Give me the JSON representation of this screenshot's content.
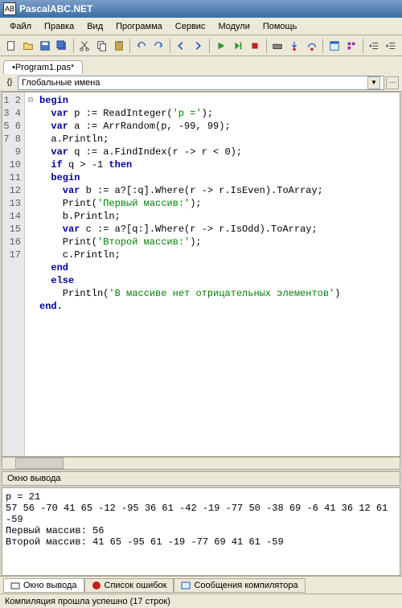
{
  "window": {
    "title": "PascalABC.NET",
    "icon_label": "AB"
  },
  "menu": {
    "file": "Файл",
    "edit": "Правка",
    "view": "Вид",
    "program": "Программа",
    "service": "Сервис",
    "modules": "Модули",
    "help": "Помощь"
  },
  "tab": {
    "label": "•Program1.pas*"
  },
  "dropdown": {
    "text": "Глобальные имена"
  },
  "gutter_lines": "1\n2\n3\n4\n5\n6\n7\n8\n9\n10\n11\n12\n13\n14\n15\n16\n17",
  "fold_marks": "⊟\n\n\n\n\n\n\n\n\n\n\n\n\n\n\n\n",
  "code": {
    "l1a": "begin",
    "l2a": "  var",
    "l2b": " p := ReadInteger(",
    "l2c": "'p ='",
    "l2d": ");",
    "l3a": "  var",
    "l3b": " a := ArrRandom(p, -99, 99);",
    "l4": "  a.Println;",
    "l5a": "  var",
    "l5b": " q := a.FindIndex(r -> r < 0);",
    "l6a": "  if",
    "l6b": " q > -1 ",
    "l6c": "then",
    "l7": "  begin",
    "l8a": "    var",
    "l8b": " b := a?[:q].Where(r -> r.IsEven).ToArray;",
    "l9a": "    Print(",
    "l9b": "'Первый массив:'",
    "l9c": ");",
    "l10": "    b.Println;",
    "l11a": "    var",
    "l11b": " c := a?[q:].Where(r -> r.IsOdd).ToArray;",
    "l12a": "    Print(",
    "l12b": "'Второй массив:'",
    "l12c": ");",
    "l13": "    c.Println;",
    "l14": "  end",
    "l15": "  else",
    "l16a": "    Println(",
    "l16b": "'В массиве нет отрицательных элементов'",
    "l16c": ")",
    "l17": "end."
  },
  "output": {
    "title": "Окно вывода",
    "content": "p = 21\n57 56 -70 41 65 -12 -95 36 61 -42 -19 -77 50 -38 69 -6 41 36 12 61 -59\nПервый массив: 56\nВторой массив: 41 65 -95 61 -19 -77 69 41 61 -59"
  },
  "bottom_tabs": {
    "output": "Окно вывода",
    "errors": "Список ошибок",
    "compiler": "Сообщения компилятора"
  },
  "status": {
    "text": "Компиляция прошла успешно (17 строк)"
  },
  "colors": {
    "keyword": "#0000a0",
    "string": "#008000"
  }
}
